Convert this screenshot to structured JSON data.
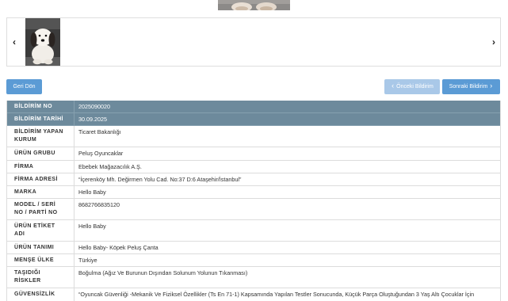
{
  "gallery": {
    "main_image": {
      "icon": "product-photo"
    },
    "prev_icon": "chevron-left-icon",
    "next_icon": "chevron-right-icon",
    "thumbnails": [
      {
        "icon": "plush-dog-thumbnail",
        "selected": true
      }
    ]
  },
  "actions": {
    "back_label": "Geri Dön",
    "prev_label": "Önceki Bildirim",
    "prev_icon": "chevron-left-icon",
    "prev_disabled": true,
    "next_label": "Sonraki Bildirim",
    "next_icon": "chevron-right-icon"
  },
  "details": {
    "rows": [
      {
        "label": [
          "BİLDİRİM NO"
        ],
        "value": "2025090020",
        "highlight": true
      },
      {
        "label": [
          "BİLDİRİM TARİHİ"
        ],
        "value": "30.09.2025",
        "highlight": true
      },
      {
        "label": [
          "BİLDİRİM YAPAN",
          "KURUM"
        ],
        "value": "Ticaret Bakanlığı"
      },
      {
        "label": [
          "ÜRÜN GRUBU"
        ],
        "value": "Peluş Oyuncaklar"
      },
      {
        "label": [
          "FİRMA"
        ],
        "value": "Ebebek Mağazacılık A.Ş."
      },
      {
        "label": [
          "FİRMA ADRESİ"
        ],
        "value": "“İçerenköy Mh. Değirmen Yolu Cad. No:37 D:6 Ataşehir/İstanbul”"
      },
      {
        "label": [
          "MARKA"
        ],
        "value": "Hello Baby"
      },
      {
        "label": [
          "MODEL / SERİ",
          "NO / PARTİ NO"
        ],
        "value": "8682766835120"
      },
      {
        "label": [
          "ÜRÜN ETİKET",
          "ADI"
        ],
        "value": "Hello Baby"
      },
      {
        "label": [
          "ÜRÜN TANIMI"
        ],
        "value": "Hello Baby- Köpek Peluş Çanta"
      },
      {
        "label": [
          "MENŞE ÜLKE"
        ],
        "value": "Türkiye"
      },
      {
        "label": [
          "TAŞIDIĞI",
          "RİSKLER"
        ],
        "value": "Boğulma (Ağız Ve Burunun Dışından Solunum Yolunun Tıkanması)"
      },
      {
        "label": [
          "GÜVENSİZLİK"
        ],
        "value": "“Oyuncak Güvenliği -Mekanik Ve Fiziksel Özellikler (Ts En 71-1) Kapsamında Yapılan Testler Sonucunda, Küçük Parça Oluştuğundan 3 Yaş Altı Çocuklar İçin"
      }
    ]
  },
  "colors": {
    "button": "#5b9bd5",
    "button_disabled": "#a9c8e8",
    "header_row": "#6d8a9c",
    "border": "#dcdcdc",
    "text": "#333333"
  }
}
